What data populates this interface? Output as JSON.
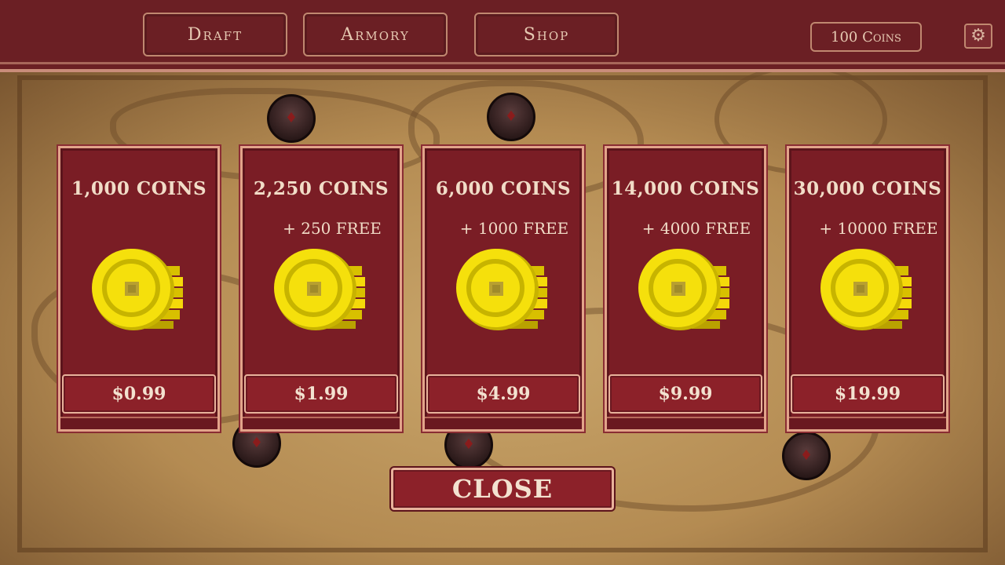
{
  "nav": {
    "tabs": [
      {
        "label": "Draft"
      },
      {
        "label": "Armory"
      },
      {
        "label": "Shop"
      }
    ],
    "coins_label": "100 Coins",
    "settings_icon": "gear-icon"
  },
  "shop": {
    "packs": [
      {
        "title": "1,000 COINS",
        "bonus": "",
        "price": "$0.99"
      },
      {
        "title": "2,250 COINS",
        "bonus": "+ 250 FREE",
        "price": "$1.99"
      },
      {
        "title": "6,000 COINS",
        "bonus": "+ 1000 FREE",
        "price": "$4.99"
      },
      {
        "title": "14,000 COINS",
        "bonus": "+ 4000 FREE",
        "price": "$9.99"
      },
      {
        "title": "30,000 COINS",
        "bonus": "+ 10000 FREE",
        "price": "$19.99"
      }
    ],
    "close_label": "CLOSE"
  },
  "colors": {
    "panel": "#7a1d25",
    "border": "#e2a48a",
    "coin": "#f5d90a",
    "map": "#c9a66b"
  }
}
